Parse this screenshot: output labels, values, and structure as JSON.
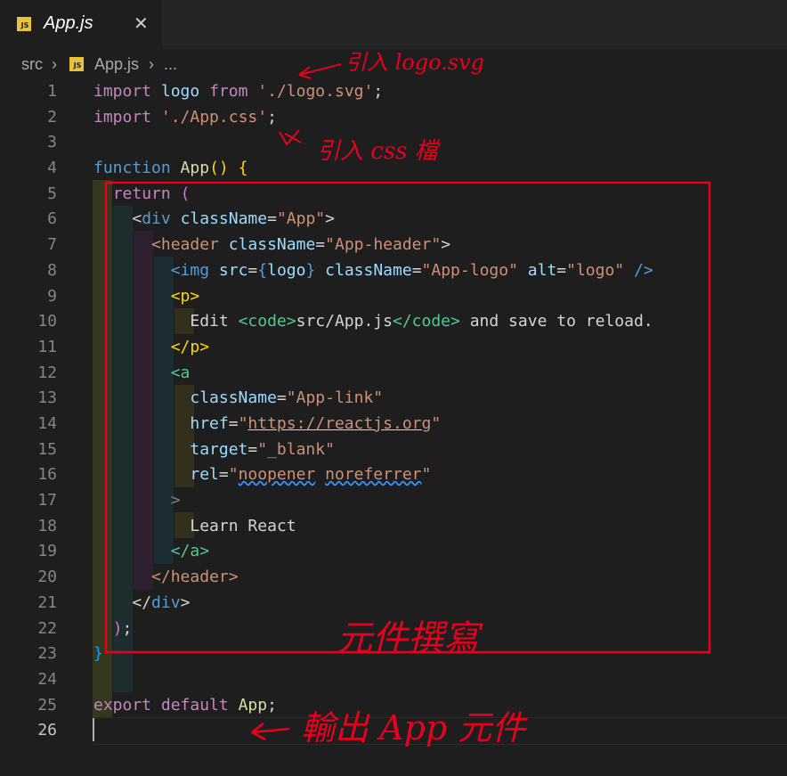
{
  "tab": {
    "badge": "JS",
    "title": "App.js",
    "close": "✕"
  },
  "breadcrumb": {
    "folder": "src",
    "sep1": "›",
    "badge": "JS",
    "file": "App.js",
    "sep2": "›",
    "more": "..."
  },
  "line_numbers": [
    "1",
    "2",
    "3",
    "4",
    "5",
    "6",
    "7",
    "8",
    "9",
    "10",
    "11",
    "12",
    "13",
    "14",
    "15",
    "16",
    "17",
    "18",
    "19",
    "20",
    "21",
    "22",
    "23",
    "24",
    "25",
    "26"
  ],
  "active_line": "26",
  "code": {
    "l1": [
      "import",
      "logo",
      "from",
      "'./logo.svg'",
      ";"
    ],
    "l2": [
      "import",
      "'./App.css'",
      ";"
    ],
    "l4": [
      "function",
      "App",
      "()",
      "{"
    ],
    "l5": [
      "return",
      "("
    ],
    "l6": [
      "<",
      "div",
      "className",
      "=",
      "\"App\"",
      ">"
    ],
    "l7": [
      "<",
      "header",
      "className",
      "=",
      "\"App-header\"",
      ">"
    ],
    "l8": [
      "<",
      "img",
      "src",
      "=",
      "{",
      "logo",
      "}",
      "className",
      "=",
      "\"App-logo\"",
      "alt",
      "=",
      "\"logo\"",
      "/>"
    ],
    "l9": [
      "<",
      "p",
      ">"
    ],
    "l10": [
      "Edit ",
      "<",
      "code",
      ">",
      "src/App.js",
      "</",
      "code",
      ">",
      " and save to reload."
    ],
    "l11": [
      "</",
      "p",
      ">"
    ],
    "l12": [
      "<",
      "a"
    ],
    "l13": [
      "className",
      "=",
      "\"App-link\""
    ],
    "l14": [
      "href",
      "=",
      "\"",
      "https://reactjs.org",
      "\""
    ],
    "l15": [
      "target",
      "=",
      "\"_blank\""
    ],
    "l16": [
      "rel",
      "=",
      "\"",
      "noopener",
      " ",
      "noreferrer",
      "\""
    ],
    "l17": [
      ">"
    ],
    "l18": [
      "Learn React"
    ],
    "l19": [
      "</",
      "a",
      ">"
    ],
    "l20": [
      "</",
      "header",
      ">"
    ],
    "l21": [
      "</",
      "div",
      ">"
    ],
    "l22": [
      ")",
      ";"
    ],
    "l23": [
      "}"
    ],
    "l25": [
      "export",
      "default",
      "App",
      ";"
    ]
  },
  "annotations": {
    "a1": "引入 logo.svg",
    "a2": "引入 css 檔",
    "a3": "元件撰寫",
    "a4": "輸出 App 元件"
  },
  "colors": {
    "annotation_red": "#e8001e",
    "keyword": "#c586c0",
    "tag": "#569cd6",
    "string": "#ce9178"
  }
}
